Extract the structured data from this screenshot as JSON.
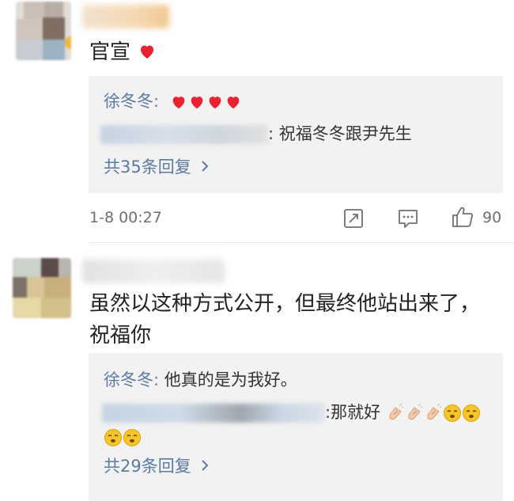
{
  "comments": [
    {
      "text": "官宣",
      "replies": [
        {
          "author": "徐冬冬:",
          "text": ""
        },
        {
          "author": "",
          "text": ": 祝福冬冬跟尹先生"
        }
      ],
      "more_replies": "共35条回复",
      "time": "1-8 00:27",
      "likes": "90"
    },
    {
      "text_line1": "虽然以这种方式公开，但最终他站出来了，",
      "text_line2": "祝福你",
      "replies": [
        {
          "author": "徐冬冬:",
          "text": " 他真的是为我好。"
        },
        {
          "author": "",
          "text": ":那就好"
        }
      ],
      "more_replies": "共29条回复"
    }
  ],
  "icons": {
    "heart": "heart-icon",
    "share": "share-icon",
    "comment": "comment-icon",
    "like": "thumbs-up-icon",
    "chevron": "chevron-right-icon",
    "clap": "clapping-hands-icon",
    "face": "embarrassed-face-icon"
  },
  "colors": {
    "reply_author": "#5b7aa3",
    "reply_bg": "#f2f2f2",
    "heart": "#e8232f",
    "meta_text": "#6f6f6f"
  }
}
